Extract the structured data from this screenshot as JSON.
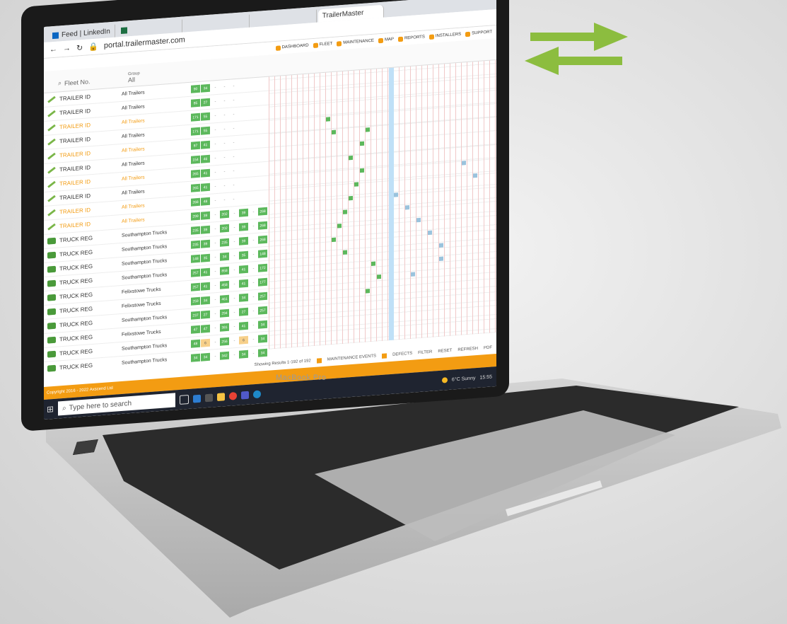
{
  "browser": {
    "tabs": [
      {
        "label": "Feed | LinkedIn"
      },
      {
        "label": ""
      },
      {
        "label": ""
      },
      {
        "label": ""
      },
      {
        "label": "TrailerMaster"
      }
    ],
    "url": "portal.trailermaster.com"
  },
  "app": {
    "nav": [
      "DASHBOARD",
      "FLEET",
      "MAINTENANCE",
      "MAP",
      "REPORTS",
      "INSTALLERS",
      "SUPPORT"
    ],
    "search_placeholder": "Fleet No.",
    "group_label": "Group",
    "group_value": "All",
    "rows": [
      {
        "id": "TRAILER ID",
        "group": "All Trailers",
        "orange": false,
        "n1": "90",
        "n2": "34",
        "extra": []
      },
      {
        "id": "TRAILER ID",
        "group": "All Trailers",
        "orange": false,
        "n1": "85",
        "n2": "27",
        "extra": []
      },
      {
        "id": "TRAILER ID",
        "group": "All Trailers",
        "orange": true,
        "n1": "171",
        "n2": "55",
        "extra": []
      },
      {
        "id": "TRAILER ID",
        "group": "All Trailers",
        "orange": false,
        "n1": "171",
        "n2": "55",
        "extra": []
      },
      {
        "id": "TRAILER ID",
        "group": "All Trailers",
        "orange": true,
        "n1": "87",
        "n2": "41",
        "extra": []
      },
      {
        "id": "TRAILER ID",
        "group": "All Trailers",
        "orange": false,
        "n1": "154",
        "n2": "46",
        "extra": []
      },
      {
        "id": "TRAILER ID",
        "group": "All Trailers",
        "orange": true,
        "n1": "265",
        "n2": "41",
        "extra": []
      },
      {
        "id": "TRAILER ID",
        "group": "All Trailers",
        "orange": false,
        "n1": "265",
        "n2": "41",
        "extra": []
      },
      {
        "id": "TRAILER ID",
        "group": "All Trailers",
        "orange": true,
        "n1": "268",
        "n2": "48",
        "extra": []
      },
      {
        "id": "TRAILER ID",
        "group": "All Trailers",
        "orange": true,
        "n1": "299",
        "n2": "39",
        "extra": [
          "202",
          "39",
          "268"
        ]
      },
      {
        "id": "TRUCK REG",
        "group": "Southampton Trucks",
        "orange": false,
        "n1": "235",
        "n2": "39",
        "extra": [
          "202",
          "39",
          "268"
        ]
      },
      {
        "id": "TRUCK REG",
        "group": "Southampton Trucks",
        "orange": false,
        "n1": "235",
        "n2": "39",
        "extra": [
          "235",
          "39",
          "268"
        ]
      },
      {
        "id": "TRUCK REG",
        "group": "Southampton Trucks",
        "orange": false,
        "n1": "148",
        "n2": "35",
        "extra": [
          "34",
          "35",
          "148"
        ]
      },
      {
        "id": "TRUCK REG",
        "group": "Southampton Trucks",
        "orange": false,
        "n1": "257",
        "n2": "41",
        "extra": [
          "858",
          "41",
          "172"
        ]
      },
      {
        "id": "TRUCK REG",
        "group": "Felixstowe Trucks",
        "orange": false,
        "n1": "257",
        "n2": "41",
        "extra": [
          "458",
          "41",
          "177"
        ]
      },
      {
        "id": "TRUCK REG",
        "group": "Felixstowe Trucks",
        "orange": false,
        "n1": "259",
        "n2": "34",
        "extra": [
          "461",
          "34",
          "257"
        ]
      },
      {
        "id": "TRUCK REG",
        "group": "Southampton Trucks",
        "orange": false,
        "n1": "237",
        "n2": "27",
        "extra": [
          "294",
          "27",
          "257"
        ]
      },
      {
        "id": "TRUCK REG",
        "group": "Felixstowe Trucks",
        "orange": false,
        "n1": "47",
        "n2": "47",
        "extra": [
          "381",
          "41",
          "34"
        ]
      },
      {
        "id": "TRUCK REG",
        "group": "Southampton Trucks",
        "orange": false,
        "n1": "48",
        "n2": "6",
        "extra": [
          "256",
          "6",
          "34"
        ]
      },
      {
        "id": "TRUCK REG",
        "group": "Southampton Trucks",
        "orange": false,
        "n1": "34",
        "n2": "34",
        "extra": [
          "342",
          "34",
          "34"
        ]
      },
      {
        "id": "TRUCK REG",
        "group": "",
        "orange": false,
        "n1": "",
        "n2": "",
        "extra": []
      }
    ],
    "status_text": "Showing Results 1-192 of 192",
    "legend": [
      "MAINTENANCE EVENTS",
      "DEFECTS"
    ],
    "actions": [
      "FILTER",
      "RESET",
      "REFRESH",
      "PDF"
    ],
    "copyright": "Copyright 2016 - 2022 Axscend Ltd"
  },
  "taskbar": {
    "search_placeholder": "Type here to search",
    "weather": "6°C Sunny",
    "time": "15:55"
  },
  "device": {
    "label": "MacBook Pro"
  },
  "colors": {
    "accent": "#f39c12",
    "green": "#5cb85c",
    "arrows": "#8cbd3f"
  }
}
